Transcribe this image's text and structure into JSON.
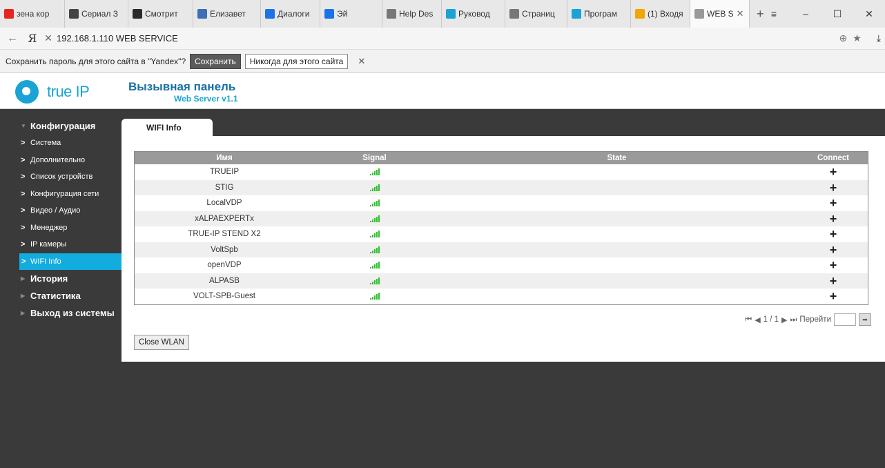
{
  "browser": {
    "tabs": [
      {
        "label": "зена кор",
        "icon": "yandex-icon",
        "color": "#e52620",
        "width": 94
      },
      {
        "label": "Сериал З",
        "icon": "masked-avatar-icon",
        "color": "#444444",
        "width": 92
      },
      {
        "label": "Смотрит",
        "icon": "play-icon",
        "color": "#2b2b2b",
        "width": 94
      },
      {
        "label": "Елизавет",
        "icon": "lang-icon",
        "color": "#3b6fb6",
        "width": 98
      },
      {
        "label": "Диалоги",
        "icon": "chat-icon",
        "color": "#1a73e8",
        "width": 86
      },
      {
        "label": "Эй",
        "icon": "play-icon",
        "color": "#1a73e8",
        "width": 90
      },
      {
        "label": "Help Des",
        "icon": "page-icon",
        "color": "#777777",
        "width": 86
      },
      {
        "label": "Руковод",
        "icon": "trueip-icon",
        "color": "#1aa3d4",
        "width": 92
      },
      {
        "label": "Страниц",
        "icon": "page-icon",
        "color": "#777777",
        "width": 90
      },
      {
        "label": "Програм",
        "icon": "trueip-icon",
        "color": "#1aa3d4",
        "width": 92
      },
      {
        "label": "(1) Входя",
        "icon": "mail-icon",
        "color": "#f2a600",
        "width": 86
      },
      {
        "label": "WEB S",
        "icon": "page-icon",
        "color": "#999999",
        "width": 86,
        "active": true
      }
    ],
    "address": "192.168.1.110  WEB SERVICE",
    "password_prompt": {
      "text": "Сохранить пароль для этого сайта в \"Yandex\"?",
      "save_label": "Сохранить",
      "never_label": "Никогда для этого сайта"
    }
  },
  "site": {
    "logo_text": "true IP",
    "title": "Вызывная панель",
    "subtitle": "Web Server v1.1"
  },
  "nav": {
    "config_label": "Конфигурация",
    "items": [
      {
        "label": "Система"
      },
      {
        "label": "Дополнительно"
      },
      {
        "label": "Список устройств"
      },
      {
        "label": "Конфигурация сети"
      },
      {
        "label": "Видео / Аудио"
      },
      {
        "label": "Менеджер"
      },
      {
        "label": "IP камеры"
      },
      {
        "label": "WIFI Info",
        "active": true
      }
    ],
    "sections": [
      {
        "label": "История"
      },
      {
        "label": "Статистика"
      },
      {
        "label": "Выход из системы"
      }
    ]
  },
  "content": {
    "tab_label": "WIFI Info",
    "columns": [
      "Имя",
      "Signal",
      "State",
      "Connect"
    ],
    "rows": [
      {
        "name": "TRUEIP",
        "signal": 5,
        "state": ""
      },
      {
        "name": "STIG",
        "signal": 5,
        "state": ""
      },
      {
        "name": "LocalVDP",
        "signal": 5,
        "state": ""
      },
      {
        "name": "xALPAEXPERTx",
        "signal": 5,
        "state": ""
      },
      {
        "name": "TRUE-IP STEND X2",
        "signal": 5,
        "state": ""
      },
      {
        "name": "VoltSpb",
        "signal": 5,
        "state": ""
      },
      {
        "name": "openVDP",
        "signal": 5,
        "state": ""
      },
      {
        "name": "ALPASB",
        "signal": 5,
        "state": ""
      },
      {
        "name": "VOLT-SPB-Guest",
        "signal": 5,
        "state": ""
      }
    ],
    "connect_symbol": "+",
    "pager": {
      "page": "1 / 1",
      "goto_label": "Перейти"
    },
    "close_label": "Close WLAN"
  },
  "colors": {
    "accent": "#12acdf",
    "signal": "#2fbf2f",
    "header_gray": "#9a9a9a"
  }
}
